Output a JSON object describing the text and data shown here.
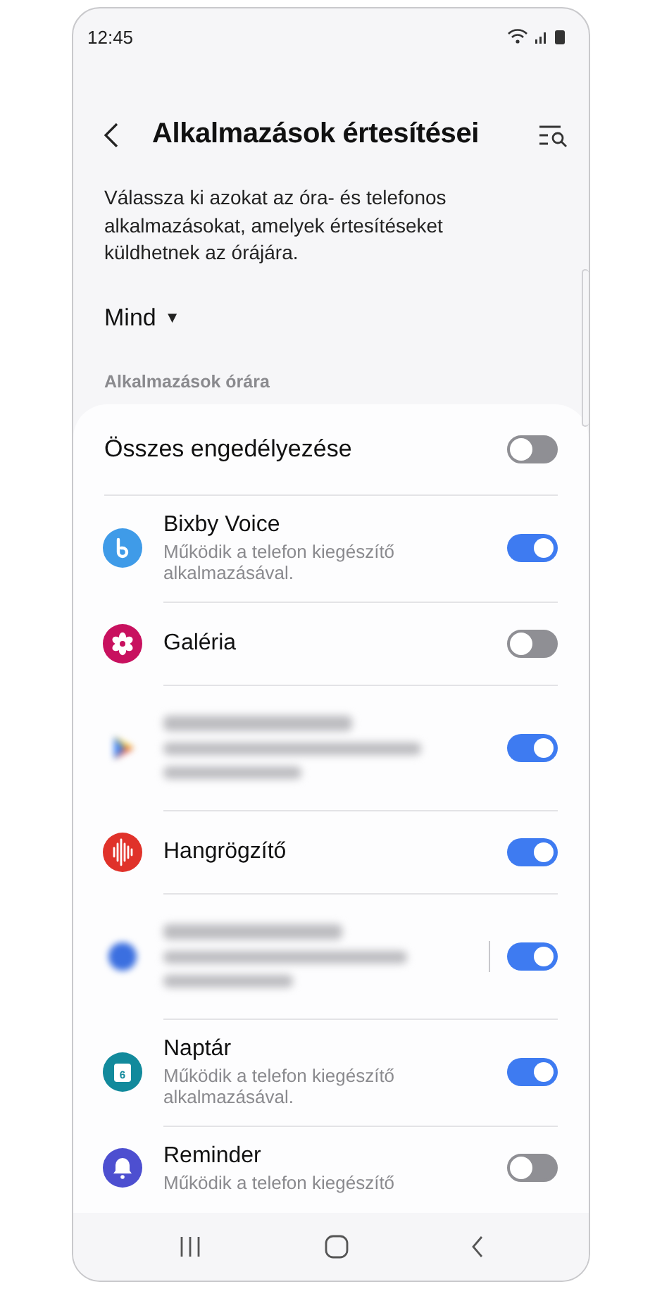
{
  "status_bar": {
    "time": "12:45"
  },
  "header": {
    "title": "Alkalmazások értesítései"
  },
  "description": "Válassza ki azokat az óra- és telefonos alkalmazásokat, amelyek értesítéseket küldhetnek az órájára.",
  "filter": {
    "label": "Mind",
    "arrow": "▼"
  },
  "section_title": "Alkalmazások órára",
  "allow_all": {
    "label": "Összes engedélyezése",
    "on": false
  },
  "apps": [
    {
      "kind": "app",
      "name": "Bixby Voice",
      "subtitle": "Működik a telefon kiegészítő alkalmazásával.",
      "color": "#3f9be8",
      "on": true
    },
    {
      "kind": "app",
      "name": "Galéria",
      "color": "#c8115f",
      "on": false
    },
    {
      "kind": "blurred",
      "on": true
    },
    {
      "kind": "app",
      "name": "Hangrögzítő",
      "color": "#e0322a",
      "on": true
    },
    {
      "kind": "blurred",
      "on": true
    },
    {
      "kind": "app",
      "name": "Naptár",
      "subtitle": "Működik a telefon kiegészítő alkalmazásával.",
      "color": "#128a9c",
      "icon_text": "6",
      "on": true
    },
    {
      "kind": "app",
      "name": "Reminder",
      "subtitle": "Működik a telefon kiegészítő",
      "color": "#4d4fd0",
      "on": false
    }
  ]
}
